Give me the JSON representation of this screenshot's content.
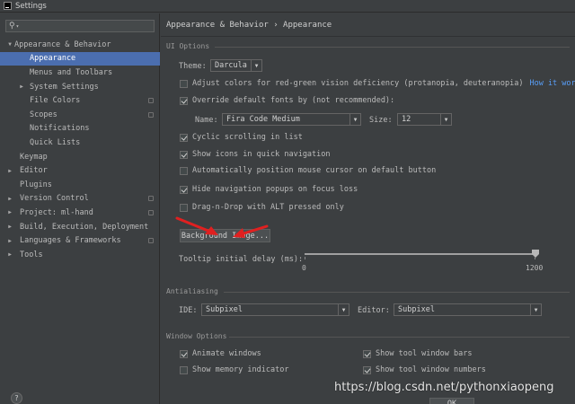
{
  "window": {
    "title": "Settings"
  },
  "search": {
    "placeholder": "Q-"
  },
  "sidebar": {
    "items": [
      {
        "label": "Appearance & Behavior",
        "arrow": "▼"
      },
      {
        "label": "Appearance"
      },
      {
        "label": "Menus and Toolbars"
      },
      {
        "label": "System Settings",
        "arrow": "▶"
      },
      {
        "label": "File Colors"
      },
      {
        "label": "Scopes"
      },
      {
        "label": "Notifications"
      },
      {
        "label": "Quick Lists"
      },
      {
        "label": "Keymap"
      },
      {
        "label": "Editor",
        "arrow": "▶"
      },
      {
        "label": "Plugins"
      },
      {
        "label": "Version Control",
        "arrow": "▶"
      },
      {
        "label": "Project: ml-hand",
        "arrow": "▶"
      },
      {
        "label": "Build, Execution, Deployment",
        "arrow": "▶"
      },
      {
        "label": "Languages & Frameworks",
        "arrow": "▶"
      },
      {
        "label": "Tools",
        "arrow": "▶"
      }
    ]
  },
  "breadcrumb": "Appearance & Behavior › Appearance",
  "ui_options": {
    "title": "UI Options",
    "theme_label": "Theme:",
    "theme_value": "Darcula",
    "red_green": "Adjust colors for red-green vision deficiency (protanopia, deuteranopia)",
    "how_it_works": "How it works",
    "override_fonts": "Override default fonts by (not recommended):",
    "name_label": "Name:",
    "font_name": "Fira Code Medium",
    "size_label": "Size:",
    "font_size": "12",
    "cyclic": "Cyclic scrolling in list",
    "show_icons": "Show icons in quick navigation",
    "auto_mouse": "Automatically position mouse cursor on default button",
    "hide_nav": "Hide navigation popups on focus loss",
    "drag_drop": "Drag-n-Drop with ALT pressed only",
    "background_image": "Background Image...",
    "tooltip_label": "Tooltip initial delay (ms):",
    "tooltip_min": "0",
    "tooltip_max": "1200",
    "tooltip_value": 1200
  },
  "antialiasing": {
    "title": "Antialiasing",
    "ide_label": "IDE:",
    "ide_value": "Subpixel",
    "editor_label": "Editor:",
    "editor_value": "Subpixel"
  },
  "window_options": {
    "title": "Window Options",
    "animate": "Animate windows",
    "show_memory": "Show memory indicator",
    "show_tool_bars": "Show tool window bars",
    "show_tool_numbers": "Show tool window numbers"
  },
  "footer": {
    "help": "?",
    "ok": "OK"
  },
  "watermark": "https://blog.csdn.net/pythonxiaopeng"
}
